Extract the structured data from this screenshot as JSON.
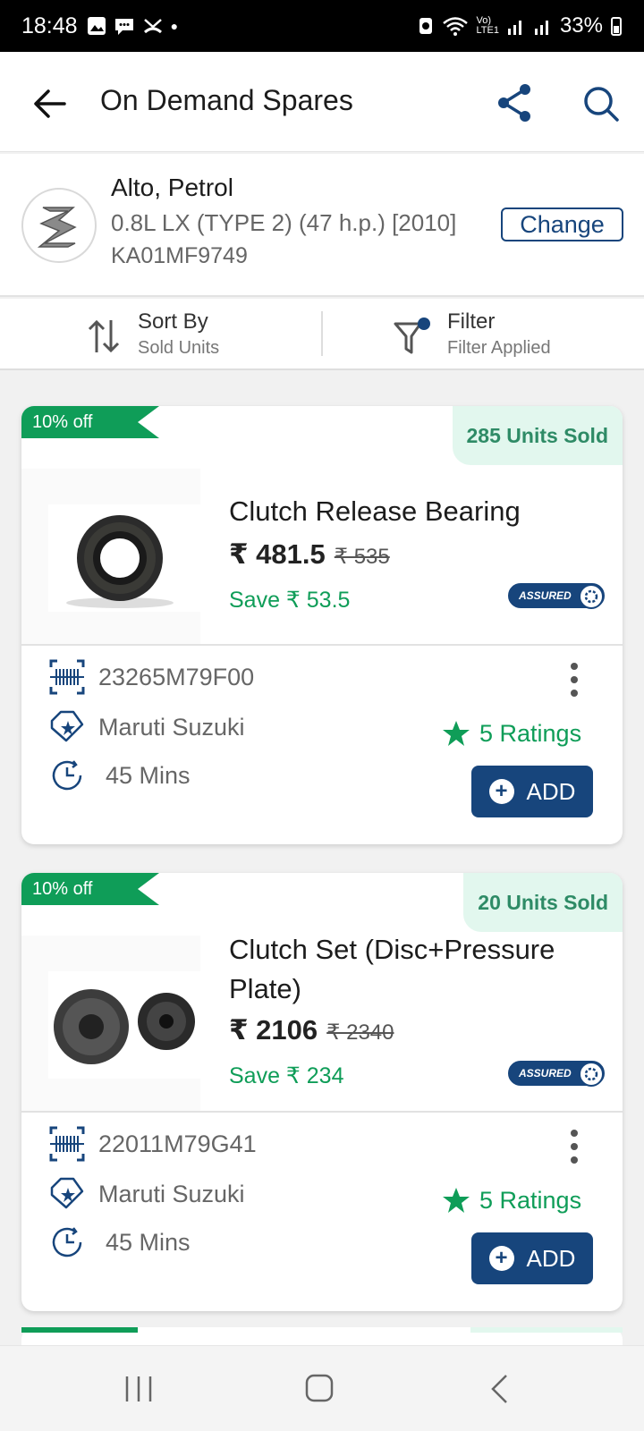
{
  "status_bar": {
    "time": "18:48",
    "battery": "33%"
  },
  "app_bar": {
    "title": "On Demand Spares"
  },
  "vehicle": {
    "name": "Alto, Petrol",
    "variant": "0.8L LX (TYPE 2) (47 h.p.) [2010]",
    "registration": "KA01MF9749",
    "change_label": "Change"
  },
  "sort": {
    "label": "Sort By",
    "value": "Sold Units"
  },
  "filter": {
    "label": "Filter",
    "value": "Filter Applied"
  },
  "products": [
    {
      "discount": "10% off",
      "sold": "285 Units Sold",
      "name": "Clutch Release Bearing",
      "price": "₹ 481.5",
      "mrp": "₹ 535",
      "save": "Save ₹ 53.5",
      "assured": "ASSURED",
      "part_no": "23265M79F00",
      "brand": "Maruti Suzuki",
      "eta": "45 Mins",
      "ratings": "5 Ratings",
      "add_label": "ADD"
    },
    {
      "discount": "10% off",
      "sold": "20 Units Sold",
      "name": "Clutch Set (Disc+Pressure Plate)",
      "price": "₹ 2106",
      "mrp": "₹ 2340",
      "save": "Save ₹ 234",
      "assured": "ASSURED",
      "part_no": "22011M79G41",
      "brand": "Maruti Suzuki",
      "eta": "45 Mins",
      "ratings": "5 Ratings",
      "add_label": "ADD"
    }
  ],
  "colors": {
    "primary": "#17457c",
    "green": "#0f9d58",
    "sold_bg": "#e2f7ee"
  }
}
